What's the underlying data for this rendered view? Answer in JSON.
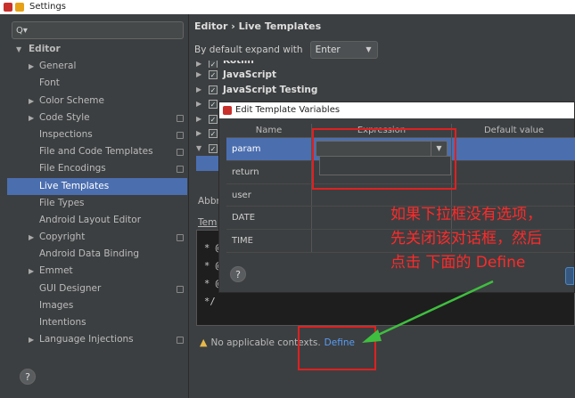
{
  "window": {
    "title": "Settings"
  },
  "sidebar": {
    "search_placeholder": "Q▾",
    "items": [
      {
        "label": "Editor",
        "arrow": "▼",
        "indent": 0,
        "bold": true
      },
      {
        "label": "General",
        "arrow": "▶",
        "indent": 1
      },
      {
        "label": "Font",
        "arrow": "",
        "indent": 1
      },
      {
        "label": "Color Scheme",
        "arrow": "▶",
        "indent": 1
      },
      {
        "label": "Code Style",
        "arrow": "▶",
        "indent": 1,
        "copy": true
      },
      {
        "label": "Inspections",
        "arrow": "",
        "indent": 1,
        "copy": true
      },
      {
        "label": "File and Code Templates",
        "arrow": "",
        "indent": 1,
        "copy": true
      },
      {
        "label": "File Encodings",
        "arrow": "",
        "indent": 1,
        "copy": true
      },
      {
        "label": "Live Templates",
        "arrow": "",
        "indent": 1,
        "selected": true
      },
      {
        "label": "File Types",
        "arrow": "",
        "indent": 1
      },
      {
        "label": "Android Layout Editor",
        "arrow": "",
        "indent": 1
      },
      {
        "label": "Copyright",
        "arrow": "▶",
        "indent": 1,
        "copy": true
      },
      {
        "label": "Android Data Binding",
        "arrow": "",
        "indent": 1
      },
      {
        "label": "Emmet",
        "arrow": "▶",
        "indent": 1
      },
      {
        "label": "GUI Designer",
        "arrow": "",
        "indent": 1,
        "copy": true
      },
      {
        "label": "Images",
        "arrow": "",
        "indent": 1
      },
      {
        "label": "Intentions",
        "arrow": "",
        "indent": 1
      },
      {
        "label": "Language Injections",
        "arrow": "▶",
        "indent": 1,
        "copy": true
      }
    ]
  },
  "help_icon": "?",
  "header": {
    "breadcrumb": "Editor  ›  Live Templates",
    "expand_label": "By default expand with",
    "expand_value": "Enter"
  },
  "templates": [
    {
      "label": "Kotlin",
      "checked": true
    },
    {
      "label": "JavaScript",
      "checked": true
    },
    {
      "label": "JavaScript Testing",
      "checked": true
    }
  ],
  "labels": {
    "abbreviation": "Abbr",
    "template_text": "Tem"
  },
  "code_lines": [
    "* @",
    "* @",
    "* @",
    "*/"
  ],
  "warning": {
    "text": "No applicable contexts.",
    "link": "Define"
  },
  "dialog": {
    "title": "Edit Template Variables",
    "columns": [
      "Name",
      "Expression",
      "Default value"
    ],
    "rows": [
      {
        "name": "param",
        "expression": "",
        "default": ""
      },
      {
        "name": "return",
        "expression": "",
        "default": ""
      },
      {
        "name": "user",
        "expression": "",
        "default": ""
      },
      {
        "name": "DATE",
        "expression": "",
        "default": ""
      },
      {
        "name": "TIME",
        "expression": "",
        "default": ""
      }
    ]
  },
  "annotation": {
    "lines": [
      "如果下拉框没有选项，",
      "先关闭该对话框，然后",
      "点击 下面的 Define"
    ],
    "color": "#ff2a2a"
  },
  "colors": {
    "background": "#3c3f41",
    "selection": "#4b6eaf",
    "link": "#589df6",
    "highlight_box": "#e02020",
    "arrow": "#3fbf3f"
  }
}
